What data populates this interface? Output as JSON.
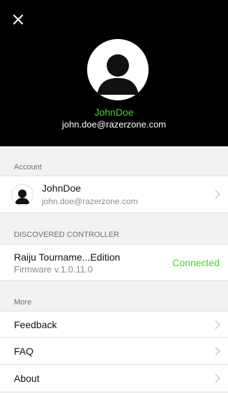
{
  "header": {
    "close_icon": "close-icon",
    "avatar_icon": "user-avatar-icon",
    "name": "JohnDoe",
    "email": "john.doe@razerzone.com",
    "name_color": "#44d62c",
    "background": "#000000"
  },
  "sections": {
    "account": {
      "title": "Account",
      "user": {
        "avatar_icon": "user-avatar-icon",
        "name": "JohnDoe",
        "email": "john.doe@razerzone.com",
        "chevron_icon": "chevron-right-icon"
      }
    },
    "discovered": {
      "title": "DISCOVERED CONTROLLER",
      "device": {
        "name": "Raiju Tourname...Edition",
        "firmware": "Firmware v.1.0.11.0",
        "status": "Connected",
        "status_color": "#44d62c"
      }
    },
    "more": {
      "title": "More",
      "items": [
        {
          "label": "Feedback",
          "chevron_icon": "chevron-right-icon"
        },
        {
          "label": "FAQ",
          "chevron_icon": "chevron-right-icon"
        },
        {
          "label": "About",
          "chevron_icon": "chevron-right-icon"
        }
      ]
    }
  }
}
